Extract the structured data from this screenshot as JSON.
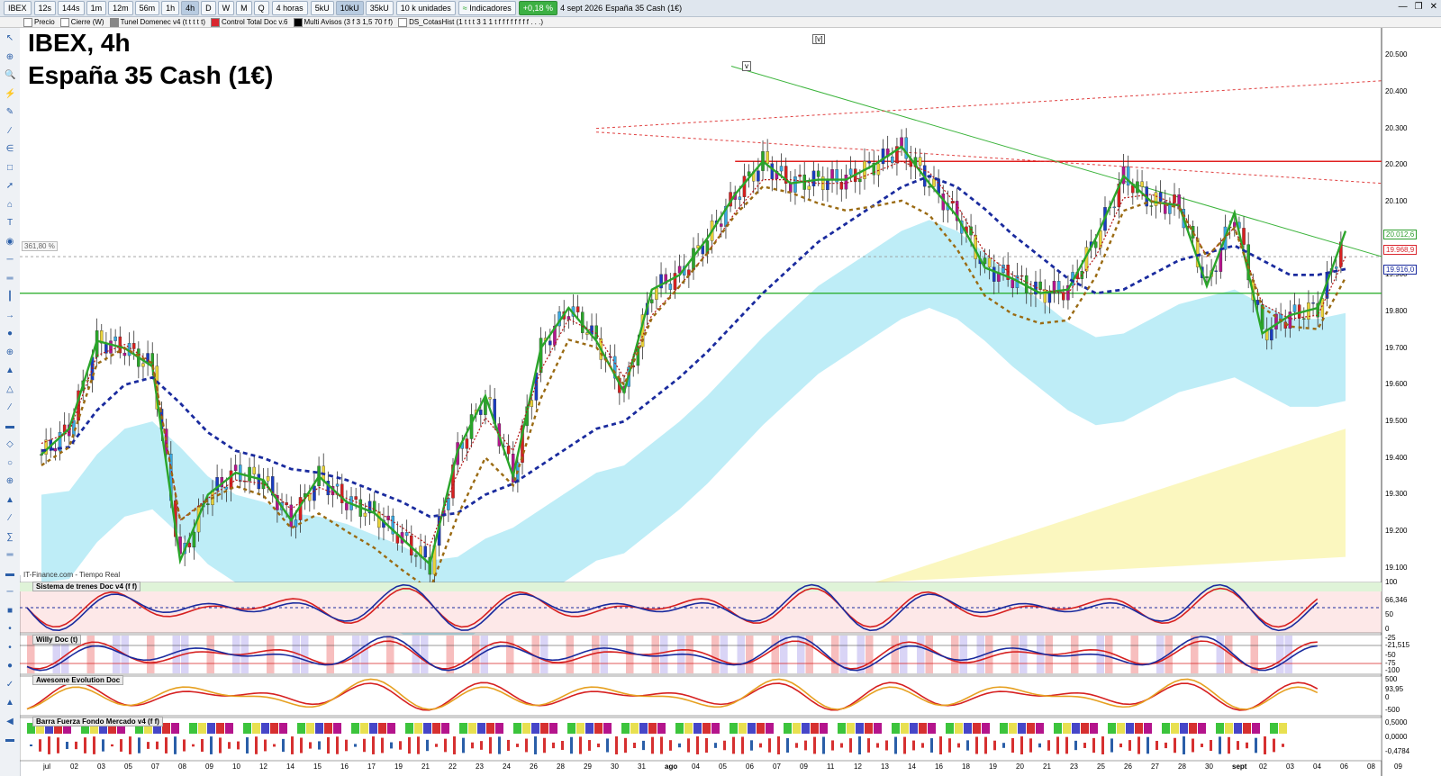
{
  "toolbar": {
    "symbol": "IBEX",
    "intervals": [
      "12s",
      "144s",
      "1m",
      "12m",
      "56m",
      "1h",
      "4h",
      "D",
      "W",
      "M",
      "Q"
    ],
    "active_interval": "4h",
    "period": "4 horas",
    "units": [
      "5kU",
      "10kU",
      "35kU"
    ],
    "unit_mode": "10 k unidades",
    "indicators_label": "Indicadores",
    "change": "+0,18 %",
    "date": "4 sept 2026",
    "instrument": "España 35 Cash (1€)"
  },
  "indicator_bar": [
    {
      "label": "Precio",
      "color": "#ffffff"
    },
    {
      "label": "Cierre (W)",
      "color": "#ffffff"
    },
    {
      "label": "Tunel Domenec v4 (t t t t t)",
      "color": "#888888"
    },
    {
      "label": "Control Total Doc v.6",
      "color": "#d9262e"
    },
    {
      "label": "Multi Avisos (3 f 3 1,5 70 f f)",
      "color": "#000000"
    },
    {
      "label": "DS_CotasHist (1 t t t 3 1 1 t f f f f f f f f . . .)",
      "color": "#ffffff"
    }
  ],
  "chart": {
    "title": "IBEX, 4h",
    "subtitle": "España 35 Cash (1€)",
    "source": "IT-Finance.com - Tiempo Real",
    "fib_label": "361,80 %",
    "tags": [
      "v",
      "[v]"
    ],
    "price_axis": [
      "20.500",
      "20.400",
      "20.300",
      "20.200",
      "20.100",
      "19.900",
      "19.800",
      "19.700",
      "19.600",
      "19.500",
      "19.400",
      "19.300",
      "19.200",
      "19.100"
    ],
    "price_tags": [
      {
        "text": "20.012,6",
        "color": "#2e9d2e"
      },
      {
        "text": "19.968,9",
        "color": "#d9262e"
      },
      {
        "text": "19.916,0",
        "color": "#1a2b9e"
      }
    ],
    "x_axis": [
      "jul",
      "02",
      "03",
      "05",
      "07",
      "08",
      "09",
      "10",
      "12",
      "14",
      "15",
      "16",
      "17",
      "19",
      "21",
      "22",
      "23",
      "24",
      "26",
      "28",
      "29",
      "30",
      "31",
      "ago",
      "04",
      "05",
      "06",
      "07",
      "09",
      "11",
      "12",
      "13",
      "14",
      "16",
      "18",
      "19",
      "20",
      "21",
      "23",
      "25",
      "26",
      "27",
      "28",
      "30",
      "sept",
      "02",
      "03",
      "04",
      "06",
      "08",
      "09"
    ]
  },
  "chart_data": {
    "type": "line",
    "title": "IBEX, 4h",
    "x": [
      "jul",
      "02",
      "03",
      "05",
      "07",
      "08",
      "09",
      "10",
      "12",
      "14",
      "15",
      "16",
      "17",
      "19",
      "21",
      "22",
      "23",
      "24",
      "26",
      "28",
      "29",
      "30",
      "31",
      "ago",
      "04",
      "05",
      "06",
      "07",
      "09",
      "11",
      "12",
      "13",
      "14",
      "16",
      "18",
      "19",
      "20",
      "21",
      "23",
      "25",
      "26",
      "27",
      "28",
      "30",
      "sept",
      "02",
      "03",
      "04"
    ],
    "series": [
      {
        "values": [
          19410,
          19480,
          19720,
          19700,
          19650,
          19120,
          19300,
          19360,
          19340,
          19230,
          19350,
          19280,
          19250,
          19180,
          19110,
          19420,
          19570,
          19350,
          19700,
          19810,
          19720,
          19580,
          19860,
          19900,
          20000,
          20120,
          20210,
          20150,
          20160,
          20160,
          20200,
          20250,
          20150,
          20060,
          19920,
          19890,
          19850,
          19860,
          20000,
          20170,
          20100,
          20090,
          19870,
          20070,
          19740,
          19790,
          19810,
          20020
        ]
      },
      {
        "values": [
          19440,
          19470,
          19680,
          19710,
          19660,
          19230,
          19290,
          19340,
          19330,
          19260,
          19320,
          19290,
          19260,
          19210,
          19160,
          19360,
          19510,
          19420,
          19640,
          19780,
          19740,
          19620,
          19790,
          19870,
          19960,
          20070,
          20160,
          20160,
          20150,
          20150,
          20180,
          20210,
          20180,
          20090,
          19960,
          19900,
          19860,
          19850,
          19950,
          20110,
          20120,
          20090,
          19950,
          20030,
          19820,
          19780,
          19790,
          19950
        ]
      },
      {
        "values": [
          19420,
          19430,
          19530,
          19600,
          19620,
          19550,
          19470,
          19420,
          19400,
          19370,
          19360,
          19340,
          19310,
          19280,
          19240,
          19250,
          19300,
          19330,
          19380,
          19430,
          19480,
          19500,
          19560,
          19620,
          19690,
          19770,
          19850,
          19920,
          19990,
          20040,
          20090,
          20140,
          20170,
          20140,
          20080,
          20010,
          19950,
          19890,
          19850,
          19860,
          19900,
          19940,
          19960,
          19980,
          19940,
          19900,
          19900,
          19916
        ]
      }
    ],
    "ylim": [
      19080,
      20540
    ],
    "grid": false,
    "horizontal_levels": [
      20210,
      19850
    ],
    "value_labels": [
      20012.6,
      19968.9,
      19916.0
    ]
  },
  "panels": [
    {
      "title": "Sistema de trenes Doc v4 (f f)",
      "axis": [
        "100",
        "66,346",
        "50",
        "0"
      ]
    },
    {
      "title": "Willy Doc (t)",
      "axis": [
        "-25",
        "-21,515",
        "-50",
        "-75",
        "-100"
      ]
    },
    {
      "title": "Awesome Evolution Doc",
      "axis": [
        "500",
        "93,95",
        "0",
        "-500"
      ]
    },
    {
      "title": "Barra Fuerza Fondo Mercado v4 (f f)",
      "axis": [
        "0,5000",
        "0,0000",
        "-0,4784"
      ]
    }
  ],
  "colors": {
    "green_line": "#2aa52a",
    "red_line": "#b41616",
    "blue_dash": "#1a2b9e",
    "brown_dash": "#9a6a12",
    "cloud": "#aee8f5",
    "yellow_band": "#fbf6b8"
  }
}
